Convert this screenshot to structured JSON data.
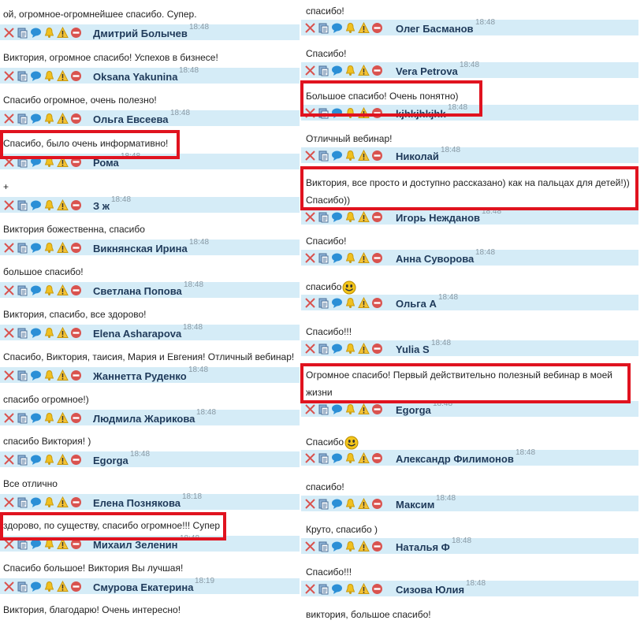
{
  "left": [
    {
      "text": "ой, огромное-огромнейшее спасибо. Супер.",
      "author": "Дмитрий Болычев",
      "time": "18:48"
    },
    {
      "text": "Виктория, огромное спасибо! Успехов в бизнесе!",
      "author": "Oksana Yakunina",
      "time": "18:48"
    },
    {
      "text": "Спасибо огромное, очень полезно!",
      "author": "Ольга Евсеева",
      "time": "18:48"
    },
    {
      "text": "Спасибо, было очень информативно!",
      "author": "Рома",
      "time": "18:48"
    },
    {
      "text": "+",
      "author": "З ж",
      "time": "18:48"
    },
    {
      "text": "Виктория божественна, спасибо",
      "author": "Викнянская Ирина",
      "time": "18:48"
    },
    {
      "text": "большое спасибо!",
      "author": "Светлана Попова",
      "time": "18:48"
    },
    {
      "text": "Виктория, спасибо, все здорово!",
      "author": "Elena Asharapova",
      "time": "18:48"
    },
    {
      "text": "Спасибо, Виктория, таисия, Мария и Евгения! Отличный вебинар!",
      "author": "Жаннетта Руденко",
      "time": "18:48"
    },
    {
      "text": "спасибо огромное!)",
      "author": "Людмила Жарикова",
      "time": "18:48"
    },
    {
      "text": "спасибо Виктория! )",
      "author": "Egorga",
      "time": "18:48"
    },
    {
      "text": "Все отлично",
      "author": "Елена Познякова",
      "time": "18:18"
    },
    {
      "text": "здорово, по существу, спасибо огромное!!! Супер",
      "author": "Михаил Зеленин",
      "time": "18:48"
    },
    {
      "text": "Спасибо большое! Виктория Вы лучшая!",
      "author": "Смурова Екатерина",
      "time": "18:19"
    },
    {
      "text": "Виктория, благодарю! Очень интересно!",
      "author": "",
      "time": ""
    }
  ],
  "right": [
    {
      "text": "спасибо!",
      "author": "Олег Басманов",
      "time": "18:48"
    },
    {
      "text": "Спасибо!",
      "author": "Vera Petrova",
      "time": "18:48"
    },
    {
      "text": "Большое спасибо!  Очень понятно)",
      "author": "kjhkjhkjhk",
      "time": "18:48"
    },
    {
      "text": "Отличный вебинар!",
      "author": "Николай",
      "time": "18:48"
    },
    {
      "text": "Виктория, все просто и доступно рассказано) как на пальцах для детей!))",
      "text2": "Спасибо))",
      "author": "Игорь Нежданов",
      "time": "18:48"
    },
    {
      "text": "Спасибо!",
      "author": "Анна Суворова",
      "time": "18:48"
    },
    {
      "text": "спасибо",
      "author": "Ольга А",
      "time": "18:48",
      "emoji": "smile-emoji"
    },
    {
      "text": "Спасибо!!!",
      "author": "Yulia S",
      "time": "18:48"
    },
    {
      "text": "Огромное спасибо! Первый действительно полезный вебинар в моей",
      "text2": "жизни",
      "author": "Egorga",
      "time": "18:48"
    },
    {
      "text": "Спасибо",
      "author": "Александр Филимонов",
      "time": "18:48",
      "emoji": "smile-emoji"
    },
    {
      "text": "спасибо!",
      "author": "Максим",
      "time": "18:48"
    },
    {
      "text": "Круто, спасибо )",
      "author": "Наталья Ф",
      "time": "18:48"
    },
    {
      "text": "Спасибо!!!",
      "author": "Сизова Юлия",
      "time": "18:48"
    },
    {
      "text": "виктория, большое спасибо!",
      "author": "",
      "time": ""
    }
  ],
  "icons": [
    "delete-icon",
    "copy-icon",
    "reply-bubble-icon",
    "bell-icon",
    "warning-icon",
    "block-icon"
  ],
  "colors": {
    "header_bg": "#d5ecf7",
    "author": "#1f3a5a",
    "highlight": "#e0131f",
    "time": "#8a9aa5"
  }
}
